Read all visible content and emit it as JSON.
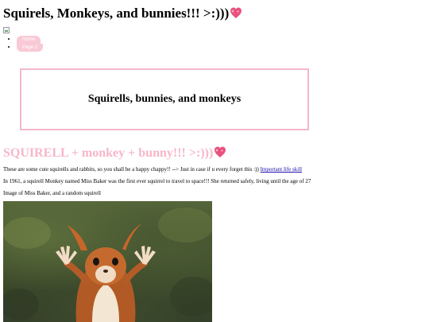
{
  "page": {
    "title": "Squirels, Monkeys, and bunnies!!! >:)))",
    "title_emoji": "sparkling-heart-icon"
  },
  "nav": {
    "items": [
      {
        "label": "Home"
      },
      {
        "label": "Page 2"
      }
    ]
  },
  "banner": {
    "title": "Squirells, bunnies, and monkeys"
  },
  "section": {
    "heading": "SQUIRELL + monkey + bunny!!! >:)))",
    "heading_emoji": "sparkling-heart-icon"
  },
  "content": {
    "intro_text": "These are some cute squirells and rabbits, so you shall be a happy chappy!! --> Just in case if u every forget this :)) ",
    "intro_link": "Important life skill",
    "fact_text": "In 1961, a squirell Monkey named Miss Baker was the first ever squirrel to travel to space!!! She returned safely, living until the age of 27",
    "image_caption": "Image of Miss Baker, and a random squirell"
  },
  "colors": {
    "accent_pink": "#f7b6c8",
    "banner_border": "#f4b9c8",
    "nav_pill": "#f9c9d6",
    "link": "#1a0dab"
  }
}
